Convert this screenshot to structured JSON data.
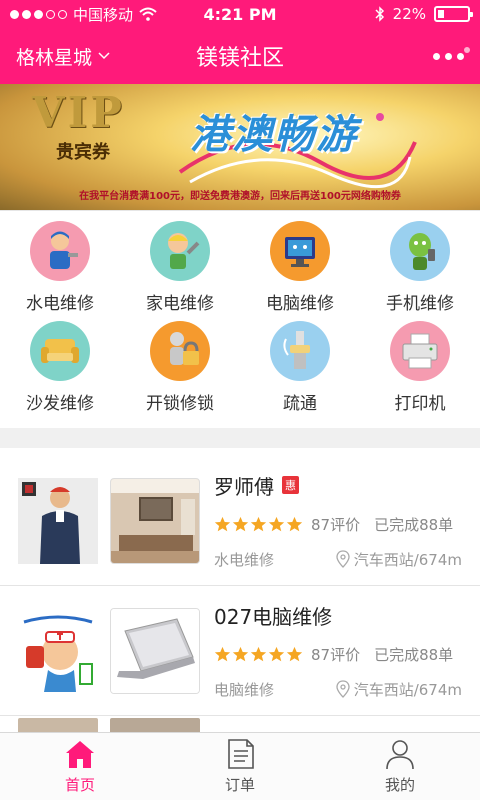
{
  "status_bar": {
    "carrier": "中国移动",
    "time": "4:21 PM",
    "battery": "22%",
    "battery_level": 0.22,
    "icons": [
      "signal-dots-icon",
      "wifi-icon",
      "bluetooth-icon",
      "battery-icon"
    ]
  },
  "header": {
    "city": "格林星城",
    "title": "镁镁社区",
    "icons": [
      "chevron-down-icon",
      "more-icon"
    ],
    "accent": "#ff1a7a"
  },
  "banner": {
    "vip": "VIP",
    "vip_sub": "贵宾券",
    "headline": "港澳畅游",
    "promo": "在我平台消费满100元，即送免费港澳游，回来后再送100元网络购物券"
  },
  "categories": [
    {
      "label": "水电维修",
      "icon": "plumber-icon",
      "bg": "#f59bb0"
    },
    {
      "label": "家电维修",
      "icon": "appliance-repair-icon",
      "bg": "#7fd3c8"
    },
    {
      "label": "电脑维修",
      "icon": "computer-repair-icon",
      "bg": "#f59a2e"
    },
    {
      "label": "手机维修",
      "icon": "phone-repair-icon",
      "bg": "#9ad0ef"
    },
    {
      "label": "沙发维修",
      "icon": "sofa-icon",
      "bg": "#7fd3c8"
    },
    {
      "label": "开锁修锁",
      "icon": "lock-icon",
      "bg": "#f59a2e"
    },
    {
      "label": "疏通",
      "icon": "pipe-icon",
      "bg": "#9ad0ef"
    },
    {
      "label": "打印机",
      "icon": "printer-icon",
      "bg": "#f59bb0"
    }
  ],
  "listings": [
    {
      "name": "罗师傅",
      "badge": "惠",
      "rating": 5,
      "reviews": "87评价",
      "completed": "已完成88单",
      "category": "水电维修",
      "location": "汽车西站/674m"
    },
    {
      "name": "027电脑维修",
      "badge": "",
      "rating": 5,
      "reviews": "87评价",
      "completed": "已完成88单",
      "category": "电脑维修",
      "location": "汽车西站/674m"
    }
  ],
  "tabbar": [
    {
      "label": "首页",
      "icon": "home-icon",
      "active": true
    },
    {
      "label": "订单",
      "icon": "order-icon",
      "active": false
    },
    {
      "label": "我的",
      "icon": "user-icon",
      "active": false
    }
  ],
  "colors": {
    "star": "#f5a623",
    "badge": "#e8333a"
  }
}
